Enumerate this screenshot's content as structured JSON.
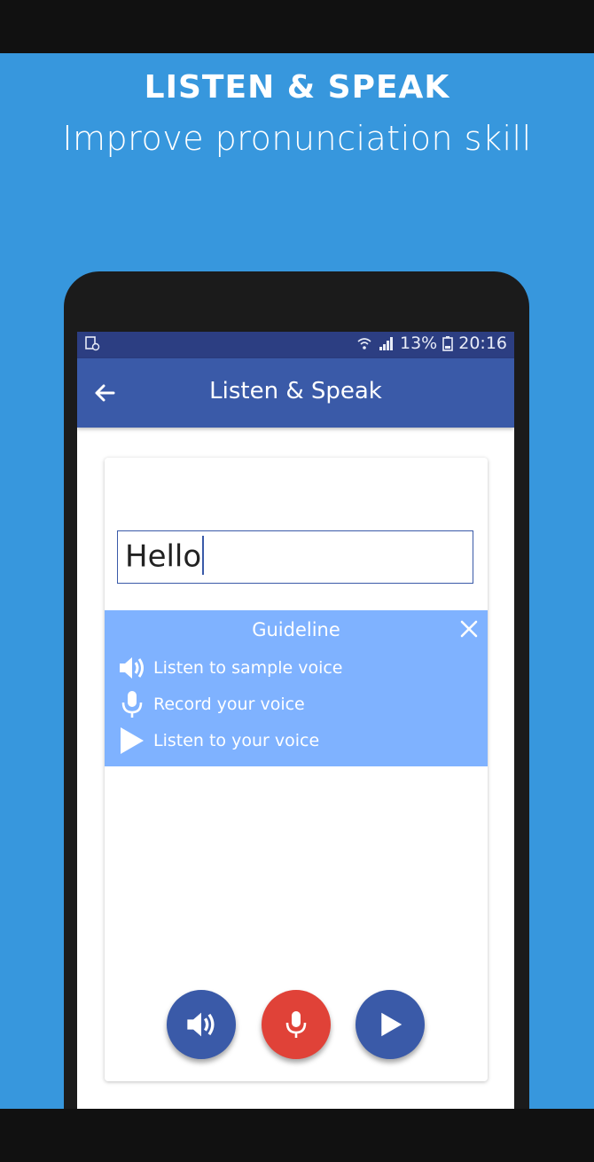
{
  "promo": {
    "title": "LISTEN & SPEAK",
    "subtitle": "Improve pronunciation skill"
  },
  "status_bar": {
    "battery": "13%",
    "time": "20:16"
  },
  "app_bar": {
    "title": "Listen & Speak"
  },
  "input": {
    "value": "Hello"
  },
  "guideline": {
    "title": "Guideline",
    "items": [
      {
        "label": "Listen to sample voice",
        "icon": "speaker-icon"
      },
      {
        "label": "Record your voice",
        "icon": "microphone-icon"
      },
      {
        "label": "Listen to your voice",
        "icon": "play-icon"
      }
    ]
  },
  "colors": {
    "background": "#3797dd",
    "app_bar": "#3a5aa8",
    "guideline": "#7fb2ff",
    "record_button": "#e04238"
  }
}
